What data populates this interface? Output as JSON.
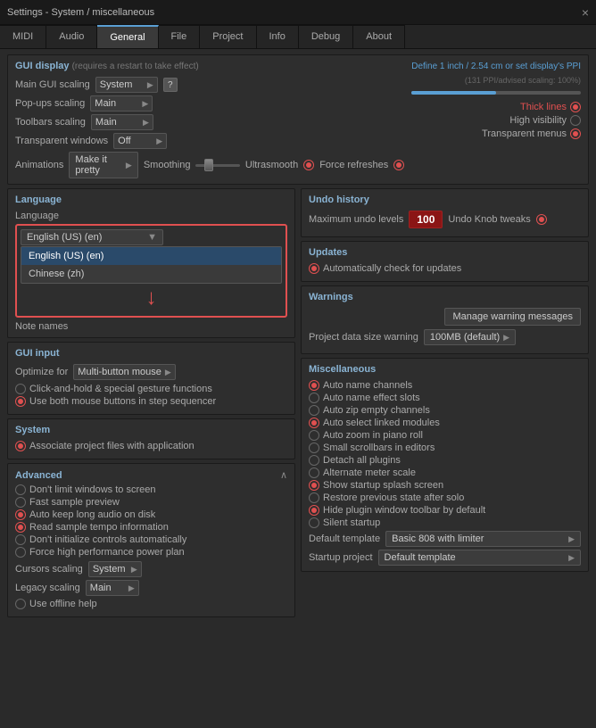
{
  "titleBar": {
    "text": "Settings - System / miscellaneous",
    "closeIcon": "×"
  },
  "tabs": [
    {
      "label": "MIDI",
      "active": false
    },
    {
      "label": "Audio",
      "active": false
    },
    {
      "label": "General",
      "active": true
    },
    {
      "label": "File",
      "active": false
    },
    {
      "label": "Project",
      "active": false
    },
    {
      "label": "Info",
      "active": false
    },
    {
      "label": "Debug",
      "active": false
    },
    {
      "label": "About",
      "active": false
    }
  ],
  "guiDisplay": {
    "title": "GUI display",
    "subtitle": "(requires a restart to take effect)",
    "mainGuiScaling": {
      "label": "Main GUI scaling",
      "value": "System"
    },
    "popUpsScaling": {
      "label": "Pop-ups scaling",
      "value": "Main"
    },
    "toolbarsScaling": {
      "label": "Toolbars scaling",
      "value": "Main"
    },
    "transparentWindows": {
      "label": "Transparent windows",
      "value": "Off"
    },
    "animations": {
      "label": "Animations",
      "value": "Make it pretty"
    },
    "ppiText": "Define 1 inch / 2.54 cm or set display's PPI",
    "ppiSubtext": "(131 PPI/advised scaling: 100%)",
    "smoothing": {
      "label": "Smoothing"
    },
    "ultrasmooth": "Ultrasmooth",
    "forceRefreshes": "Force refreshes",
    "thickLines": "Thick lines",
    "highVisibility": "High visibility",
    "transparentMenus": "Transparent menus"
  },
  "language": {
    "title": "Language",
    "languageLabel": "Language",
    "selectedLanguage": "English (US) (en)",
    "options": [
      "English (US) (en)",
      "Chinese (zh)"
    ],
    "noteNamesLabel": "Note names"
  },
  "guiInput": {
    "title": "GUI input",
    "optimizeFor": {
      "label": "Optimize for",
      "value": "Multi-button mouse"
    },
    "option1": "Click-and-hold & special gesture functions",
    "option2": "Use both mouse buttons in step sequencer"
  },
  "undoHistory": {
    "title": "Undo history",
    "maxLevelsLabel": "Maximum undo levels",
    "maxLevelsValue": "100",
    "undoKnobTweaks": "Undo Knob tweaks"
  },
  "updates": {
    "title": "Updates",
    "autoCheck": "Automatically check for updates"
  },
  "warnings": {
    "title": "Warnings",
    "manageBtn": "Manage warning messages",
    "projectDataSizeLabel": "Project data size warning",
    "projectDataSizeValue": "100MB (default)"
  },
  "system": {
    "title": "System",
    "associateFiles": "Associate project files with application"
  },
  "advanced": {
    "title": "Advanced",
    "options": [
      {
        "label": "Don't limit windows to screen",
        "active": false
      },
      {
        "label": "Fast sample preview",
        "active": false
      },
      {
        "label": "Auto keep long audio on disk",
        "active": true
      },
      {
        "label": "Read sample tempo information",
        "active": true
      },
      {
        "label": "Don't initialize controls automatically",
        "active": false
      },
      {
        "label": "Force high performance power plan",
        "active": false
      }
    ],
    "cursorsScaling": {
      "label": "Cursors scaling",
      "value": "System"
    },
    "legacyScaling": {
      "label": "Legacy scaling",
      "value": "Main"
    },
    "useOfflineHelp": "Use offline help"
  },
  "miscellaneous": {
    "title": "Miscellaneous",
    "options": [
      {
        "label": "Auto name channels",
        "active": true
      },
      {
        "label": "Auto name effect slots",
        "active": false
      },
      {
        "label": "Auto zip empty channels",
        "active": false
      },
      {
        "label": "Auto select linked modules",
        "active": true
      },
      {
        "label": "Auto zoom in piano roll",
        "active": false
      },
      {
        "label": "Small scrollbars in editors",
        "active": false
      },
      {
        "label": "Detach all plugins",
        "active": false
      },
      {
        "label": "Alternate meter scale",
        "active": false
      },
      {
        "label": "Show startup splash screen",
        "active": true
      },
      {
        "label": "Restore previous state after solo",
        "active": false
      },
      {
        "label": "Hide plugin window toolbar by default",
        "active": true
      },
      {
        "label": "Silent startup",
        "active": false
      }
    ],
    "defaultTemplateLabel": "Default template",
    "defaultTemplateValue": "Basic 808 with limiter",
    "startupProjectLabel": "Startup project",
    "startupProjectValue": "Default template"
  }
}
